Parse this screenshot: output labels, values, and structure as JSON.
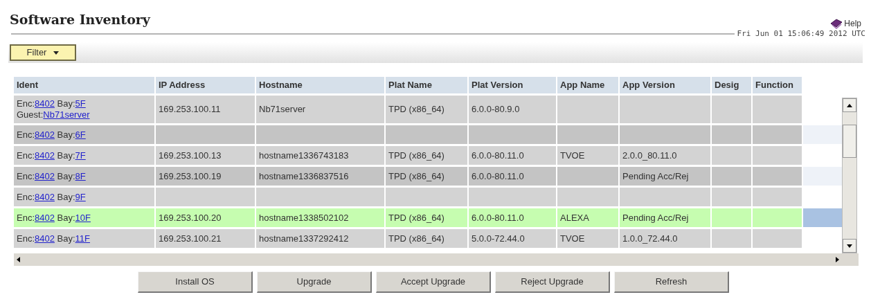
{
  "page": {
    "title": "Software Inventory",
    "help": "Help",
    "timestamp": "Fri Jun 01 15:06:49 2012 UTC"
  },
  "filter": {
    "label": "Filter"
  },
  "table": {
    "columns": [
      "Ident",
      "IP Address",
      "Hostname",
      "Plat Name",
      "Plat Version",
      "App Name",
      "App Version",
      "Desig",
      "Function"
    ],
    "rows": [
      {
        "selected": false,
        "cells": [
          {
            "lines": [
              [
                {
                  "label": "Enc:",
                  "link": "8402"
                },
                {
                  "label": "Bay:",
                  "link": "5F"
                }
              ],
              [
                {
                  "label": "Guest:",
                  "link": "Nb71server"
                }
              ]
            ]
          },
          "169.253.100.11",
          "Nb71server",
          "TPD (x86_64)",
          "6.0.0-80.9.0",
          "",
          "",
          "",
          ""
        ]
      },
      {
        "selected": false,
        "cells": [
          {
            "lines": [
              [
                {
                  "label": "Enc:",
                  "link": "8402"
                },
                {
                  "label": "Bay:",
                  "link": "6F"
                }
              ]
            ]
          },
          "",
          "",
          "",
          "",
          "",
          "",
          "",
          ""
        ]
      },
      {
        "selected": false,
        "cells": [
          {
            "lines": [
              [
                {
                  "label": "Enc:",
                  "link": "8402"
                },
                {
                  "label": "Bay:",
                  "link": "7F"
                }
              ]
            ]
          },
          "169.253.100.13",
          "hostname1336743183",
          "TPD (x86_64)",
          "6.0.0-80.11.0",
          "TVOE",
          "2.0.0_80.11.0",
          "",
          ""
        ]
      },
      {
        "selected": false,
        "cells": [
          {
            "lines": [
              [
                {
                  "label": "Enc:",
                  "link": "8402"
                },
                {
                  "label": "Bay:",
                  "link": "8F"
                }
              ]
            ]
          },
          "169.253.100.19",
          "hostname1336837516",
          "TPD (x86_64)",
          "6.0.0-80.11.0",
          "",
          "Pending Acc/Rej",
          "",
          ""
        ]
      },
      {
        "selected": false,
        "cells": [
          {
            "lines": [
              [
                {
                  "label": "Enc:",
                  "link": "8402"
                },
                {
                  "label": "Bay:",
                  "link": "9F"
                }
              ]
            ]
          },
          "",
          "",
          "",
          "",
          "",
          "",
          "",
          ""
        ]
      },
      {
        "selected": true,
        "cells": [
          {
            "lines": [
              [
                {
                  "label": "Enc:",
                  "link": "8402"
                },
                {
                  "label": "Bay:",
                  "link": "10F"
                }
              ]
            ]
          },
          "169.253.100.20",
          "hostname1338502102",
          "TPD (x86_64)",
          "6.0.0-80.11.0",
          "ALEXA",
          "Pending Acc/Rej",
          "",
          ""
        ]
      },
      {
        "selected": false,
        "cells": [
          {
            "lines": [
              [
                {
                  "label": "Enc:",
                  "link": "8402"
                },
                {
                  "label": "Bay:",
                  "link": "11F"
                }
              ]
            ]
          },
          "169.253.100.21",
          "hostname1337292412",
          "TPD (x86_64)",
          "5.0.0-72.44.0",
          "TVOE",
          "1.0.0_72.44.0",
          "",
          ""
        ]
      }
    ]
  },
  "buttons": [
    "Install OS",
    "Upgrade",
    "Accept Upgrade",
    "Reject Upgrade",
    "Refresh"
  ]
}
